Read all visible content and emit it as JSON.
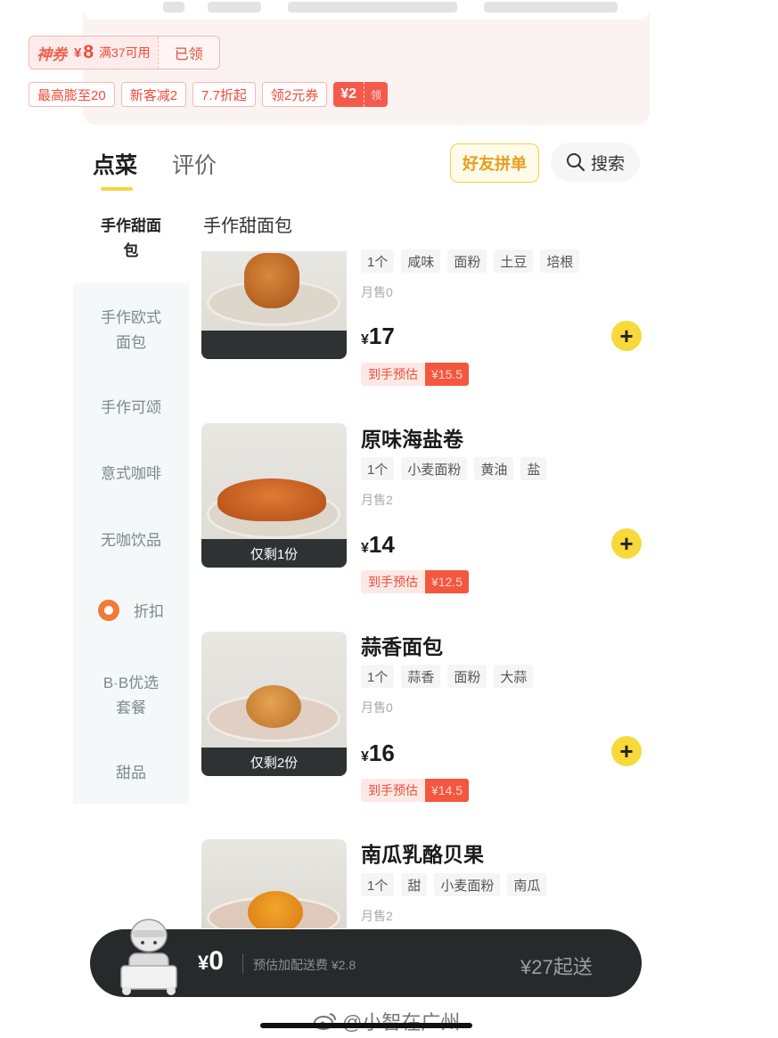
{
  "promo": {
    "coupon": {
      "brand": "神券",
      "currency": "¥",
      "amount": "8",
      "condition": "满37可用",
      "status": "已领"
    },
    "tags": [
      "最高膨至20",
      "新客减2",
      "7.7折起",
      "领2元券"
    ],
    "red_tag": {
      "amount": "¥2",
      "action": "领"
    }
  },
  "tabs": {
    "menu": "点菜",
    "reviews": "评价"
  },
  "actions": {
    "group_order": "好友拼单",
    "search": "搜索"
  },
  "sidebar": {
    "items": [
      "手作甜面包",
      "手作欧式面包",
      "手作可颂",
      "意式咖啡",
      "无咖饮品",
      "折扣",
      "B·B优选套餐",
      "甜品"
    ]
  },
  "section_title": "手作甜面包",
  "products": [
    {
      "name": "",
      "tags": [
        "1个",
        "咸味",
        "面粉",
        "土豆",
        "培根"
      ],
      "sold": "月售0",
      "currency": "¥",
      "price": "17",
      "est_label": "到手预估",
      "est_price": "¥15.5",
      "stock": ""
    },
    {
      "name": "原味海盐卷",
      "tags": [
        "1个",
        "小麦面粉",
        "黄油",
        "盐"
      ],
      "sold": "月售2",
      "currency": "¥",
      "price": "14",
      "est_label": "到手预估",
      "est_price": "¥12.5",
      "stock": "仅剩1份"
    },
    {
      "name": "蒜香面包",
      "tags": [
        "1个",
        "蒜香",
        "面粉",
        "大蒜"
      ],
      "sold": "月售0",
      "currency": "¥",
      "price": "16",
      "est_label": "到手预估",
      "est_price": "¥14.5",
      "stock": "仅剩2份"
    },
    {
      "name": "南瓜乳酪贝果",
      "tags": [
        "1个",
        "甜",
        "小麦面粉",
        "南瓜"
      ],
      "sold": "月售2",
      "currency": "¥",
      "price": "",
      "est_label": "",
      "est_price": "",
      "stock": ""
    }
  ],
  "cart": {
    "currency": "¥",
    "total": "0",
    "delivery_note": "预估加配送费 ¥2.8",
    "minimum": "¥27起送"
  },
  "watermark": "@小智在广州",
  "colors": {
    "accent_yellow": "#f7d93a",
    "promo_red": "#ef4b3c",
    "cart_bg": "#262a2a"
  }
}
